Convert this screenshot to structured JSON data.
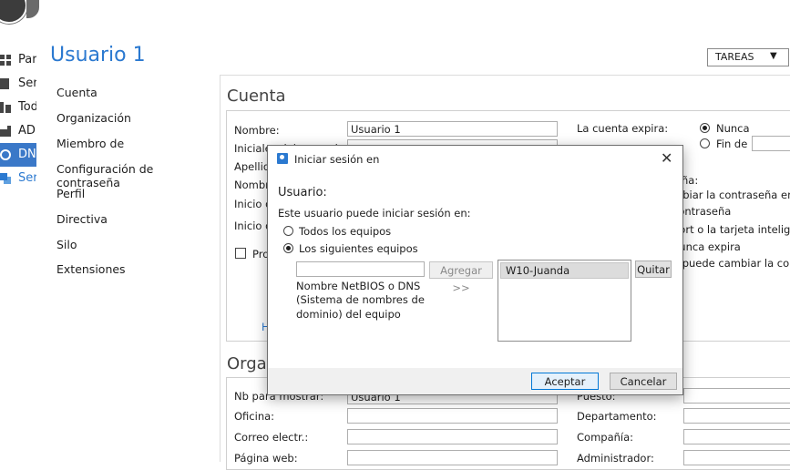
{
  "left_nav": {
    "items": [
      {
        "label": "Par",
        "icon": "grid-icon"
      },
      {
        "label": "Ser",
        "icon": "server-icon"
      },
      {
        "label": "Tod",
        "icon": "servers-icon"
      },
      {
        "label": "AD",
        "icon": "ad-icon"
      },
      {
        "label": "DN",
        "icon": "dns-icon"
      },
      {
        "label": "Ser",
        "icon": "services-icon"
      }
    ]
  },
  "header": {
    "title": "Usuario 1",
    "tasks_label": "TAREAS",
    "tasks_arrow": "▼"
  },
  "side_menu": [
    "Cuenta",
    "Organización",
    "Miembro de",
    "Configuración de contraseña",
    "Perfil",
    "Directiva",
    "Silo",
    "Extensiones"
  ],
  "account": {
    "section_title": "Cuenta",
    "labels": [
      "Nombre:",
      "Iniciales del segundo",
      "Apellid",
      "Nombr",
      "Inicio d",
      "Inicio d"
    ],
    "name_value": "Usuario 1",
    "protect_label": "Pro",
    "link_fragment": "H",
    "expires_label": "La cuenta expira:",
    "never_label": "Nunca",
    "end_label": "Fin de",
    "right_fragments": [
      "ña:",
      "mbiar la contraseña en",
      "contraseña",
      "port o la tarjeta intelige",
      "nunca expira",
      "o puede cambiar la con"
    ]
  },
  "organization": {
    "section_title": "Organización",
    "display_label": "Nb para mostrar:",
    "display_value": "Usuario 1",
    "office_label": "Oficina:",
    "email_label": "Correo electr.:",
    "web_label": "Página web:",
    "post_label": "Puesto:",
    "dept_label": "Departamento:",
    "company_label": "Compañía:",
    "manager_label": "Administrador:"
  },
  "dialog": {
    "title": "Iniciar sesión en",
    "close": "✕",
    "heading": "Usuario:",
    "prompt": "Este usuario puede iniciar sesión en:",
    "option_all": "Todos los equipos",
    "option_following": "Los siguientes equipos",
    "computer_input_value": "",
    "add_button": "Agregar >>",
    "help_text_1": "Nombre NetBIOS o DNS",
    "help_text_2": "(Sistema de nombres de",
    "help_text_3": "dominio) del equipo",
    "computers": [
      "W10-Juanda"
    ],
    "remove_button": "Quitar",
    "ok_button": "Aceptar",
    "cancel_button": "Cancelar"
  }
}
